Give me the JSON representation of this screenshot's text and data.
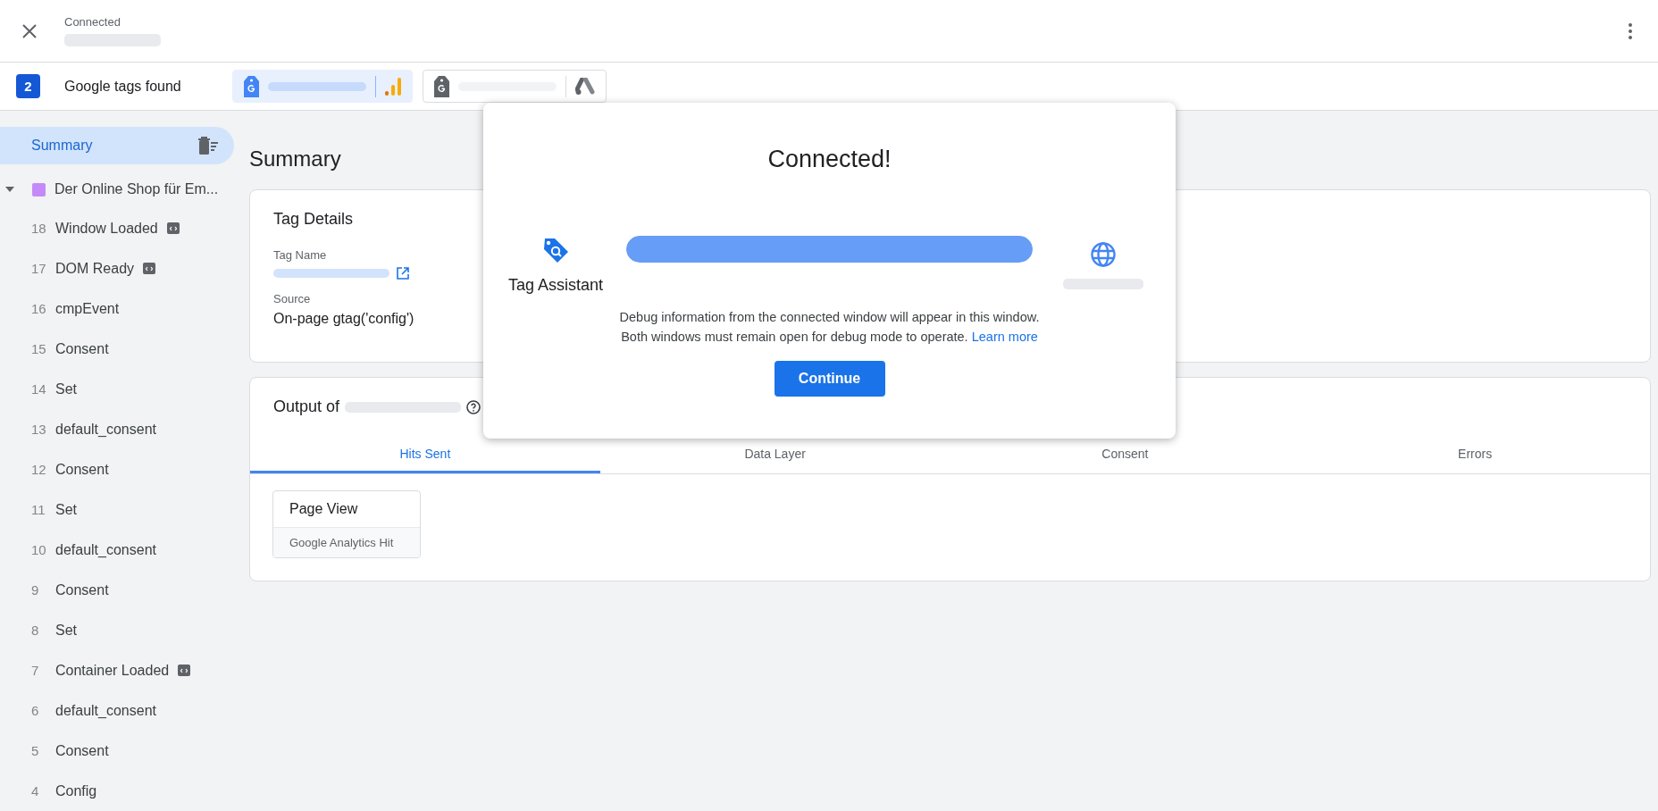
{
  "header": {
    "status": "Connected"
  },
  "tags_bar": {
    "count": "2",
    "label": "Google tags found",
    "tags": [
      {
        "kind": "analytics",
        "selected": true
      },
      {
        "kind": "ads",
        "selected": false
      }
    ]
  },
  "sidebar": {
    "items": [
      {
        "label": "Summary",
        "selected": true
      }
    ],
    "container": {
      "label": "Der Online Shop für Em...",
      "color": "#c58af9",
      "expanded": true,
      "children": [
        {
          "number": "18",
          "label": "Window Loaded",
          "code_icon": true
        },
        {
          "number": "17",
          "label": "DOM Ready",
          "code_icon": true
        },
        {
          "number": "16",
          "label": "cmpEvent",
          "code_icon": false
        },
        {
          "number": "15",
          "label": "Consent",
          "code_icon": false
        },
        {
          "number": "14",
          "label": "Set",
          "code_icon": false
        },
        {
          "number": "13",
          "label": "default_consent",
          "code_icon": false
        },
        {
          "number": "12",
          "label": "Consent",
          "code_icon": false
        },
        {
          "number": "11",
          "label": "Set",
          "code_icon": false
        },
        {
          "number": "10",
          "label": "default_consent",
          "code_icon": false
        },
        {
          "number": "9",
          "label": "Consent",
          "code_icon": false
        },
        {
          "number": "8",
          "label": "Set",
          "code_icon": false
        },
        {
          "number": "7",
          "label": "Container Loaded",
          "code_icon": true
        },
        {
          "number": "6",
          "label": "default_consent",
          "code_icon": false
        },
        {
          "number": "5",
          "label": "Consent",
          "code_icon": false
        },
        {
          "number": "4",
          "label": "Config",
          "code_icon": false
        }
      ]
    }
  },
  "main": {
    "title": "Summary",
    "tag_details": {
      "title": "Tag Details",
      "fields": [
        {
          "label": "Tag Name",
          "kind": "redacted_link"
        },
        {
          "label": "Source",
          "value": "On-page gtag('config')",
          "kind": "text"
        }
      ]
    },
    "output": {
      "title": "Output of",
      "tabs": [
        {
          "label": "Hits Sent",
          "selected": true
        },
        {
          "label": "Data Layer",
          "selected": false
        },
        {
          "label": "Consent",
          "selected": false
        },
        {
          "label": "Errors",
          "selected": false
        }
      ],
      "hits": [
        {
          "title": "Page View",
          "subtitle": "Google Analytics Hit"
        }
      ]
    }
  },
  "dialog": {
    "title": "Connected!",
    "left_label": "Tag Assistant",
    "level": 1,
    "lines": [
      "Debug information from the connected window will appear in this window.",
      "Both windows must remain open for debug mode to operate."
    ],
    "link": "Learn more",
    "button": "Continue"
  }
}
